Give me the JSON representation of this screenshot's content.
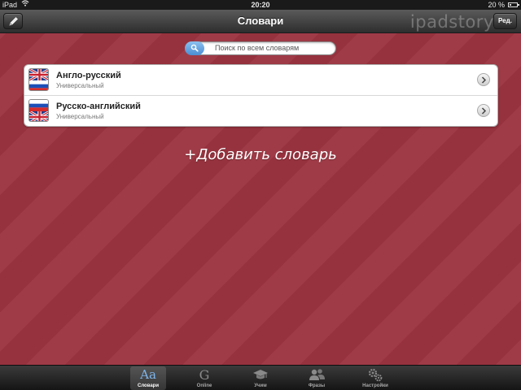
{
  "status_bar": {
    "device": "iPad",
    "time": "20:20",
    "battery": "20 %"
  },
  "nav_bar": {
    "title": "Словари",
    "edit_label": "Ред.",
    "watermark": "ipadstory.ru"
  },
  "search": {
    "placeholder": "Поиск по всем словарям",
    "icon": "search-icon",
    "accent": "#4a8ed4"
  },
  "dictionaries": [
    {
      "name": "Англо-русский",
      "subtitle": "Универсальный",
      "flags": [
        "uk",
        "russia"
      ]
    },
    {
      "name": "Русско-английский",
      "subtitle": "Универсальный",
      "flags": [
        "russia",
        "uk"
      ]
    }
  ],
  "add_dictionary_label": "+Добавить словарь",
  "tab_bar": {
    "tabs": [
      {
        "label": "Словари",
        "icon": "font-aa-icon",
        "active": true
      },
      {
        "label": "Online",
        "icon": "google-g-icon",
        "active": false
      },
      {
        "label": "Учим",
        "icon": "graduation-cap-icon",
        "active": false
      },
      {
        "label": "Фразы",
        "icon": "people-icon",
        "active": false
      },
      {
        "label": "Настройки",
        "icon": "gears-icon",
        "active": false
      }
    ]
  },
  "colors": {
    "background": "#9c3440",
    "active_tab_icon": "#7fb5ea"
  }
}
